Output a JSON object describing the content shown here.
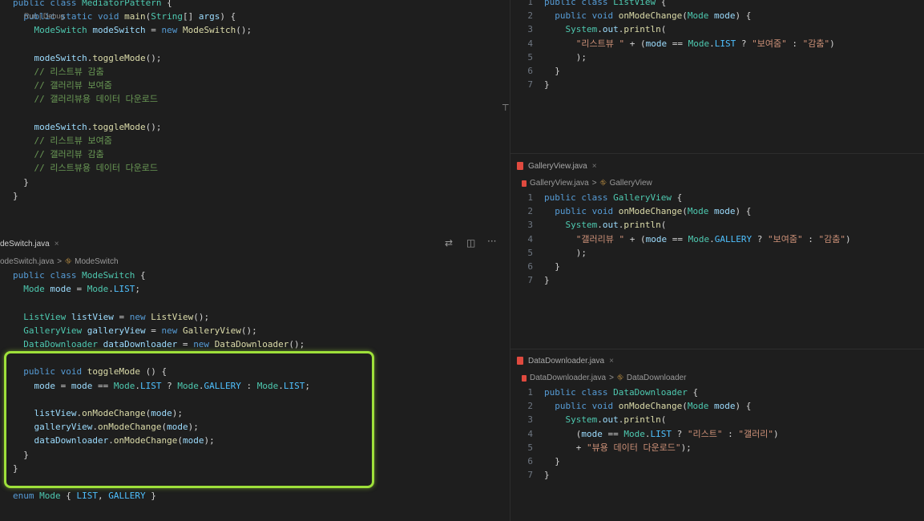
{
  "left_top": {
    "lines": [
      {
        "html": "<span class='kw'>public</span> <span class='kw'>class</span> <span class='ty'>MediatorPattern</span> {"
      },
      {
        "html": "<span class='kw'>  public</span> <span class='kw'>static</span> <span class='kw'>void</span> <span class='fn'>main</span>(<span class='ty'>String</span>[] <span class='vr'>args</span>) {"
      },
      {
        "html": "    <span class='ty'>ModeSwitch</span> <span class='vr'>modeSwitch</span> = <span class='kw'>new</span> <span class='fn'>ModeSwitch</span>();"
      },
      {
        "html": ""
      },
      {
        "html": "    <span class='vr'>modeSwitch</span>.<span class='fn'>toggleMode</span>();"
      },
      {
        "html": "    <span class='cm'>// 리스트뷰 감춤</span>"
      },
      {
        "html": "    <span class='cm'>// 갤러리뷰 보여줌</span>"
      },
      {
        "html": "    <span class='cm'>// 갤러리뷰용 데이터 다운로드</span>"
      },
      {
        "html": ""
      },
      {
        "html": "    <span class='vr'>modeSwitch</span>.<span class='fn'>toggleMode</span>();"
      },
      {
        "html": "    <span class='cm'>// 리스트뷰 보여줌</span>"
      },
      {
        "html": "    <span class='cm'>// 갤러리뷰 감춤</span>"
      },
      {
        "html": "    <span class='cm'>// 리스트뷰용 데이터 다운로드</span>"
      },
      {
        "html": "  }"
      },
      {
        "html": "}"
      }
    ],
    "run_debug": "Run | Debug"
  },
  "left_bottom": {
    "tab": "deSwitch.java",
    "breadcrumb_file": "odeSwitch.java",
    "breadcrumb_symbol": "ModeSwitch",
    "lines": [
      {
        "html": "<span class='kw'>public</span> <span class='kw'>class</span> <span class='ty'>ModeSwitch</span> {"
      },
      {
        "html": "  <span class='ty'>Mode</span> <span class='vr'>mode</span> = <span class='ty'>Mode</span>.<span class='en'>LIST</span>;"
      },
      {
        "html": ""
      },
      {
        "html": "  <span class='ty'>ListView</span> <span class='vr'>listView</span> = <span class='kw'>new</span> <span class='fn'>ListView</span>();"
      },
      {
        "html": "  <span class='ty'>GalleryView</span> <span class='vr'>galleryView</span> = <span class='kw'>new</span> <span class='fn'>GalleryView</span>();"
      },
      {
        "html": "  <span class='ty'>DataDownloader</span> <span class='vr'>dataDownloader</span> = <span class='kw'>new</span> <span class='fn'>DataDownloader</span>();"
      },
      {
        "html": ""
      },
      {
        "html": "  <span class='kw'>public</span> <span class='kw'>void</span> <span class='fn'>toggleMode</span> () {"
      },
      {
        "html": "    <span class='vr'>mode</span> = <span class='vr'>mode</span> == <span class='ty'>Mode</span>.<span class='en'>LIST</span> ? <span class='ty'>Mode</span>.<span class='en'>GALLERY</span> : <span class='ty'>Mode</span>.<span class='en'>LIST</span>;"
      },
      {
        "html": ""
      },
      {
        "html": "    <span class='vr'>listView</span>.<span class='fn'>onModeChange</span>(<span class='vr'>mode</span>);"
      },
      {
        "html": "    <span class='vr'>galleryView</span>.<span class='fn'>onModeChange</span>(<span class='vr'>mode</span>);"
      },
      {
        "html": "    <span class='vr'>dataDownloader</span>.<span class='fn'>onModeChange</span>(<span class='vr'>mode</span>);"
      },
      {
        "html": "  }"
      },
      {
        "html": "}"
      },
      {
        "html": ""
      },
      {
        "html": "<span class='kw'>enum</span> <span class='ty'>Mode</span> { <span class='en'>LIST</span>, <span class='en'>GALLERY</span> }"
      }
    ]
  },
  "right_top": {
    "lines": [
      {
        "n": "1",
        "html": "<span class='kw'>public</span> <span class='kw'>class</span> <span class='ty'>ListView</span> {"
      },
      {
        "n": "2",
        "html": "  <span class='kw'>public</span> <span class='kw'>void</span> <span class='fn'>onModeChange</span>(<span class='ty'>Mode</span> <span class='vr'>mode</span>) {"
      },
      {
        "n": "3",
        "html": "    <span class='ty'>System</span>.<span class='vr'>out</span>.<span class='fn'>println</span>("
      },
      {
        "n": "4",
        "html": "      <span class='st'>\"리스트뷰 \"</span> + (<span class='vr'>mode</span> == <span class='ty'>Mode</span>.<span class='en'>LIST</span> ? <span class='st'>\"보여줌\"</span> : <span class='st'>\"감춤\"</span>)"
      },
      {
        "n": "5",
        "html": "      );"
      },
      {
        "n": "6",
        "html": "  }"
      },
      {
        "n": "7",
        "html": "}"
      }
    ]
  },
  "right_mid": {
    "tab": "GalleryView.java",
    "breadcrumb_file": "GalleryView.java",
    "breadcrumb_symbol": "GalleryView",
    "lines": [
      {
        "n": "1",
        "html": "<span class='kw'>public</span> <span class='kw'>class</span> <span class='ty'>GalleryView</span> {"
      },
      {
        "n": "2",
        "html": "  <span class='kw'>public</span> <span class='kw'>void</span> <span class='fn'>onModeChange</span>(<span class='ty'>Mode</span> <span class='vr'>mode</span>) {"
      },
      {
        "n": "3",
        "html": "    <span class='ty'>System</span>.<span class='vr'>out</span>.<span class='fn'>println</span>("
      },
      {
        "n": "4",
        "html": "      <span class='st'>\"갤러리뷰 \"</span> + (<span class='vr'>mode</span> == <span class='ty'>Mode</span>.<span class='en'>GALLERY</span> ? <span class='st'>\"보여줌\"</span> : <span class='st'>\"감춤\"</span>)"
      },
      {
        "n": "5",
        "html": "      );"
      },
      {
        "n": "6",
        "html": "  }"
      },
      {
        "n": "7",
        "html": "}"
      }
    ]
  },
  "right_bottom": {
    "tab": "DataDownloader.java",
    "breadcrumb_file": "DataDownloader.java",
    "breadcrumb_symbol": "DataDownloader",
    "lines": [
      {
        "n": "1",
        "html": "<span class='kw'>public</span> <span class='kw'>class</span> <span class='ty'>DataDownloader</span> {"
      },
      {
        "n": "2",
        "html": "  <span class='kw'>public</span> <span class='kw'>void</span> <span class='fn'>onModeChange</span>(<span class='ty'>Mode</span> <span class='vr'>mode</span>) {"
      },
      {
        "n": "3",
        "html": "    <span class='ty'>System</span>.<span class='vr'>out</span>.<span class='fn'>println</span>("
      },
      {
        "n": "4",
        "html": "      (<span class='vr'>mode</span> == <span class='ty'>Mode</span>.<span class='en'>LIST</span> ? <span class='st'>\"리스트\"</span> : <span class='st'>\"갤러리\"</span>)"
      },
      {
        "n": "5",
        "html": "      + <span class='st'>\"뷰용 데이터 다운로드\"</span>);"
      },
      {
        "n": "6",
        "html": "  }"
      },
      {
        "n": "7",
        "html": "}"
      }
    ]
  },
  "colors": {
    "highlight": "#9ee03a",
    "background": "#1e1e1e"
  }
}
